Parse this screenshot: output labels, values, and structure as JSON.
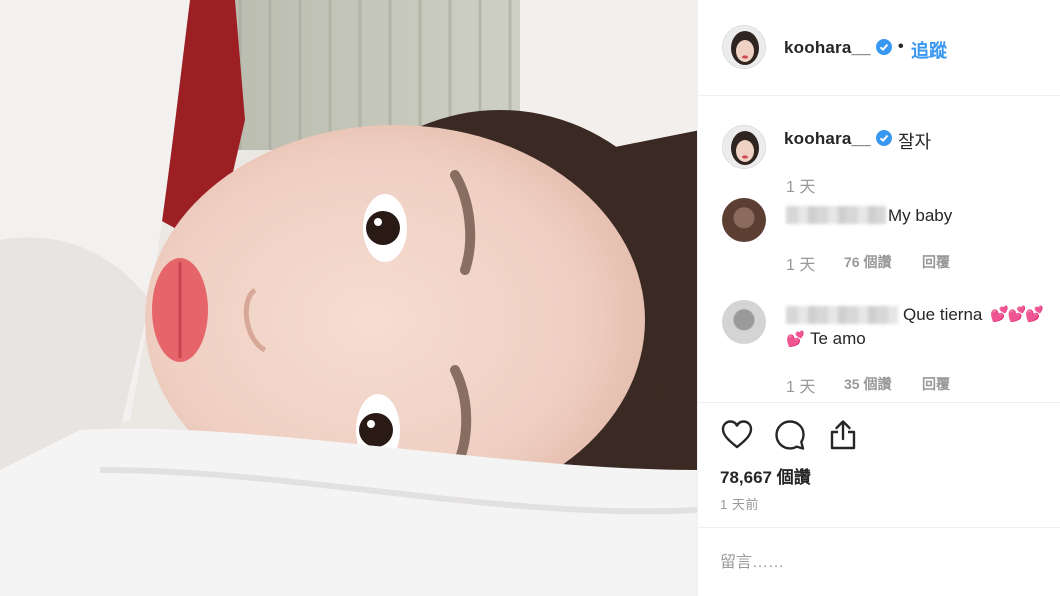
{
  "post": {
    "username": "koohara__",
    "follow_label": "追蹤",
    "separator": "•"
  },
  "caption": {
    "username": "koohara__",
    "text": "잘자",
    "time": "1 天"
  },
  "comments": [
    {
      "text": "My baby",
      "time": "1 天",
      "likes": "76 個讚",
      "reply_label": "回覆"
    },
    {
      "text_line1": "Que tierna",
      "hearts_line1": "💕💕💕",
      "hearts_line2": "💕",
      "text_line2": "Te amo",
      "time": "1 天",
      "likes": "35 個讚",
      "reply_label": "回覆"
    }
  ],
  "actions": {
    "like_icon": "heart-icon",
    "comment_icon": "comment-icon",
    "share_icon": "share-icon"
  },
  "stats": {
    "likes": "78,667 個讚",
    "posted": "1 天前"
  },
  "input": {
    "placeholder": "留言……"
  },
  "colors": {
    "accent": "#3897f0",
    "muted": "#999999",
    "text": "#262626",
    "divider": "#efefef"
  }
}
